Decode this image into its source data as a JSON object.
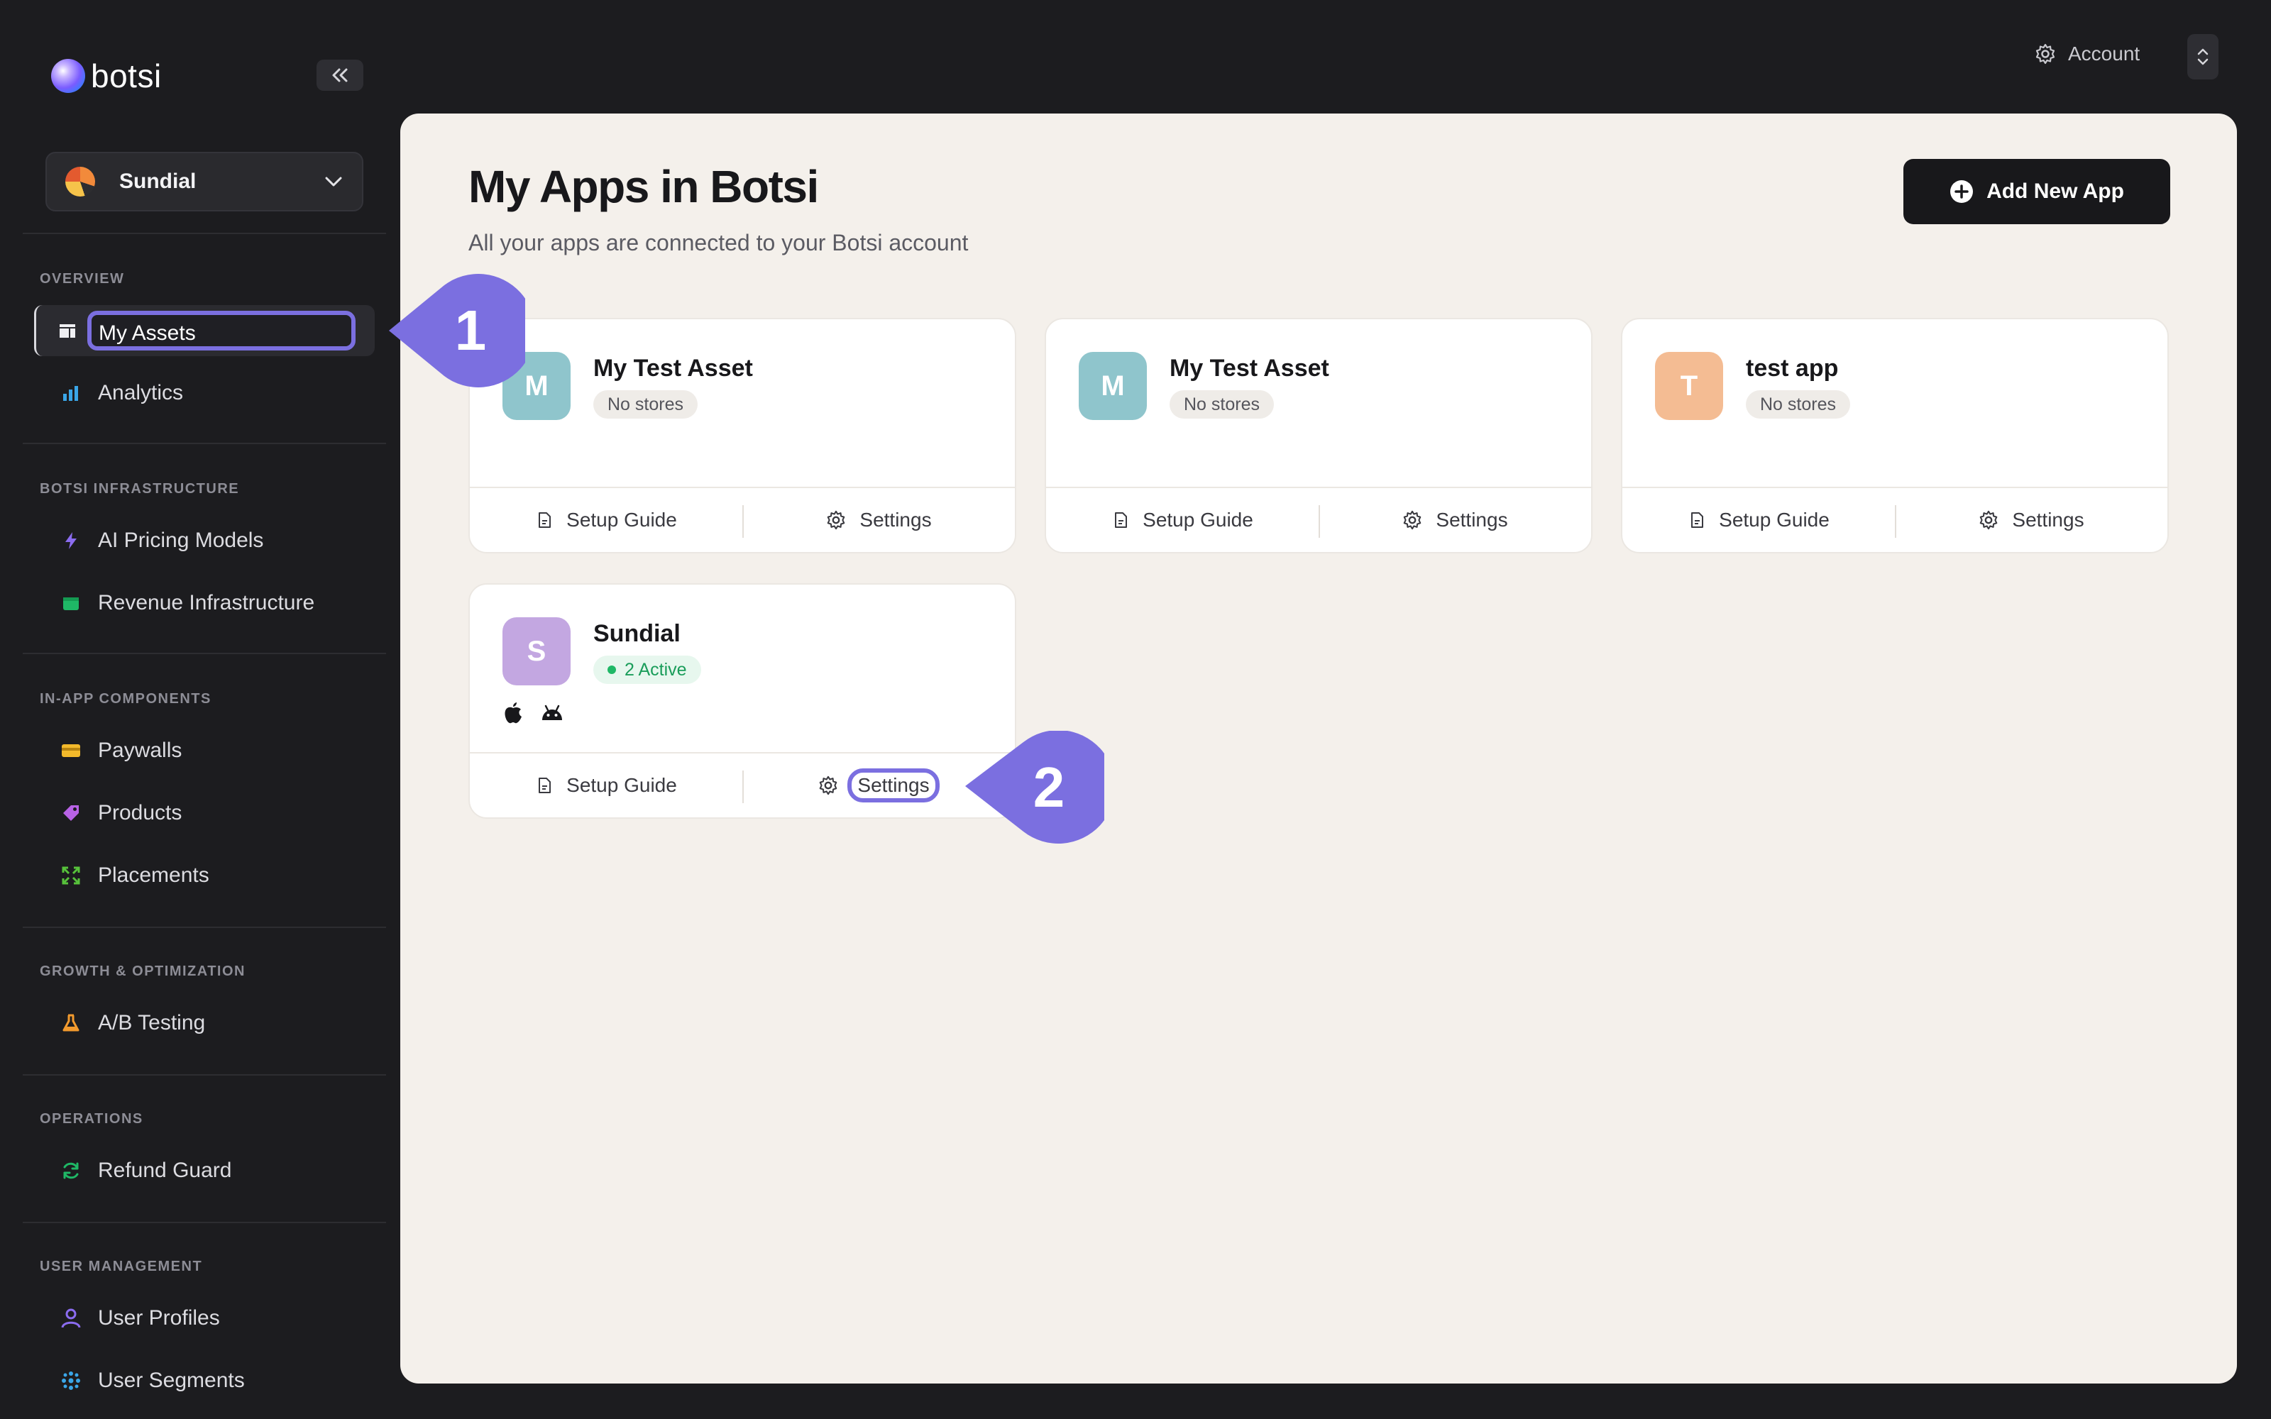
{
  "brand": {
    "name": "botsi"
  },
  "workspace": {
    "name": "Sundial"
  },
  "sidebar": {
    "sections": [
      {
        "title": "OVERVIEW",
        "items": [
          {
            "label": "My Assets",
            "icon": "assets-icon",
            "active": true
          },
          {
            "label": "Analytics",
            "icon": "bar-chart-icon"
          }
        ]
      },
      {
        "title": "BOTSI INFRASTRUCTURE",
        "items": [
          {
            "label": "AI Pricing Models",
            "icon": "lightning-icon"
          },
          {
            "label": "Revenue Infrastructure",
            "icon": "wallet-icon"
          }
        ]
      },
      {
        "title": "IN-APP COMPONENTS",
        "items": [
          {
            "label": "Paywalls",
            "icon": "credit-card-icon"
          },
          {
            "label": "Products",
            "icon": "tag-icon"
          },
          {
            "label": "Placements",
            "icon": "expand-icon"
          }
        ]
      },
      {
        "title": "GROWTH & OPTIMIZATION",
        "items": [
          {
            "label": "A/B Testing",
            "icon": "flask-icon"
          }
        ]
      },
      {
        "title": "OPERATIONS",
        "items": [
          {
            "label": "Refund Guard",
            "icon": "refresh-icon"
          }
        ]
      },
      {
        "title": "USER MANAGEMENT",
        "items": [
          {
            "label": "User Profiles",
            "icon": "user-icon"
          },
          {
            "label": "User Segments",
            "icon": "segments-icon"
          }
        ]
      }
    ]
  },
  "topbar": {
    "account_label": "Account"
  },
  "main": {
    "title": "My Apps in Botsi",
    "subtitle": "All your apps are connected to your Botsi account",
    "add_button": "Add New App",
    "apps": [
      {
        "initial": "M",
        "name": "My Test Asset",
        "status": "No stores",
        "avatar_color": "#8fc5cc"
      },
      {
        "initial": "M",
        "name": "My Test Asset",
        "status": "No stores",
        "avatar_color": "#8fc5cc"
      },
      {
        "initial": "T",
        "name": "test app",
        "status": "No stores",
        "avatar_color": "#f4bc93"
      },
      {
        "initial": "S",
        "name": "Sundial",
        "status": "2 Active",
        "avatar_color": "#c3a7e1",
        "platforms": [
          "apple-icon",
          "android-icon"
        ]
      }
    ],
    "card_actions": {
      "setup_guide": "Setup Guide",
      "settings": "Settings"
    }
  },
  "markers": {
    "step1": "1",
    "step2": "2"
  },
  "colors": {
    "marker": "#7b6fe0",
    "sidebar_bg": "#1c1c1f",
    "panel_bg": "#f4f0eb",
    "active_green": "#1a9d5a"
  }
}
